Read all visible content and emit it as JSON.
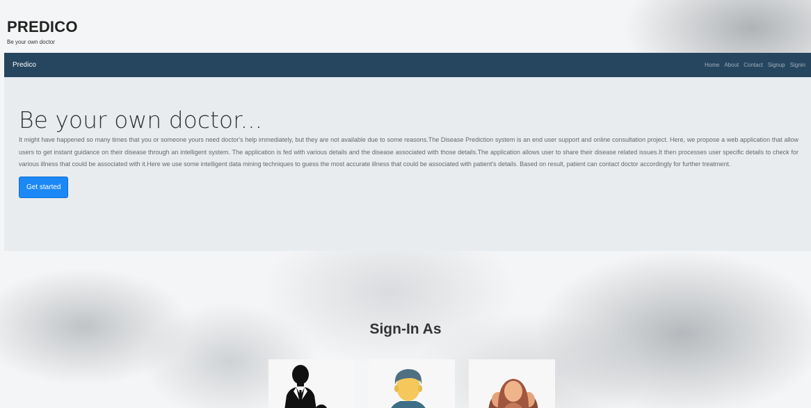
{
  "header": {
    "brand_title": "PREDICO",
    "brand_tagline": "Be your own doctor"
  },
  "navbar": {
    "brand": "Predico",
    "links": [
      "Home",
      "About",
      "Contact",
      "Signup",
      "Signin"
    ]
  },
  "hero": {
    "heading": "Be your own doctor...",
    "text": "It might have happened so many times that you or someone yours need doctor's help immediately, but they are not available due to some reasons.The Disease Prediction system is an end user support and online consultation project. Here, we propose a web application that allow users to get instant guidance on their disease through an intelligent system. The application is fed with various details and the disease associated with those details.The application allows user to share their disease related issues.It then processes user specific details to check for various illness that could be associated with it.Here we use some intelligent data mining techniques to guess the most accurate illness that could be associated with patient's details. Based on result, patient can contact doctor accordingly for further treatment.",
    "button_label": "Get started"
  },
  "signin": {
    "heading": "Sign-In As",
    "cards": [
      {
        "icon": "doctor-icon"
      },
      {
        "icon": "patient-icon"
      },
      {
        "icon": "admin-group-icon"
      }
    ]
  },
  "colors": {
    "navbar": "#264660",
    "hero_bg": "#e9ecef",
    "primary": "#1b88f5"
  }
}
